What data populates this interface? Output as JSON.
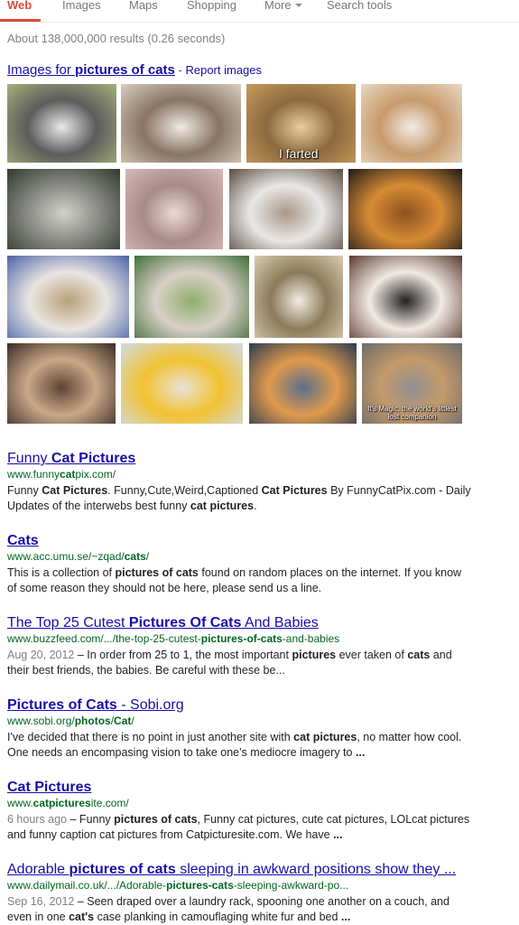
{
  "tabs": [
    "Web",
    "Images",
    "Maps",
    "Shopping",
    "More",
    "Search tools"
  ],
  "stats": "About 138,000,000 results (0.26 seconds)",
  "images_header": {
    "prefix": "Images for ",
    "query": "pictures of cats",
    "separator": " - ",
    "report": "Report images"
  },
  "image_captions": {
    "farted": "I farted",
    "magic_line1": "It's Magic, the world's littlest",
    "magic_line2": "lost companion"
  },
  "image_thumbs": [
    {
      "name": "kittens-group-bw",
      "colors": [
        "#a7b07a",
        "#5c5c5c",
        "#e9e9e9"
      ]
    },
    {
      "name": "tabby-sleeping",
      "colors": [
        "#d8cfc0",
        "#8a7462",
        "#eeeae2"
      ]
    },
    {
      "name": "tabby-smiling",
      "colors": [
        "#c89b5d",
        "#8b6a3f",
        "#e8cf9b"
      ]
    },
    {
      "name": "kitten-straw-hat",
      "colors": [
        "#e8d9c4",
        "#c79a6c",
        "#f2ede6"
      ]
    },
    {
      "name": "grey-kittens-grass",
      "colors": [
        "#2f3a2c",
        "#8a8a86",
        "#cfd3c9"
      ]
    },
    {
      "name": "cat-face-closeup",
      "colors": [
        "#d8b8b8",
        "#a88a8a",
        "#ecdad6"
      ]
    },
    {
      "name": "kittens-basket",
      "colors": [
        "#5a4a3e",
        "#e8e8e8",
        "#a89888"
      ]
    },
    {
      "name": "orange-kitten-toy",
      "colors": [
        "#1c1a18",
        "#d78b34",
        "#8c5220"
      ]
    },
    {
      "name": "three-kittens-blue",
      "colors": [
        "#4a64a8",
        "#e9e5e0",
        "#b9a07a"
      ]
    },
    {
      "name": "three-kittens-garden",
      "colors": [
        "#3f6e38",
        "#d9d0c6",
        "#8fae6e"
      ]
    },
    {
      "name": "tabby-white-portrait",
      "colors": [
        "#d9cdb0",
        "#8d7a5c",
        "#f1ece2"
      ]
    },
    {
      "name": "calico-portrait",
      "colors": [
        "#5c3b2d",
        "#f0e9e4",
        "#222222"
      ]
    },
    {
      "name": "calico-kitten-dark",
      "colors": [
        "#3a2a22",
        "#c9a889",
        "#5e4436"
      ]
    },
    {
      "name": "kitten-duck-hat",
      "colors": [
        "#cfdbe5",
        "#f2c230",
        "#e8e2d8"
      ]
    },
    {
      "name": "orange-kitten-blue",
      "colors": [
        "#2a3b4e",
        "#e09a4d",
        "#5b6f88"
      ]
    },
    {
      "name": "laughing-cat",
      "colors": [
        "#6b6b6b",
        "#c59a6a",
        "#909090"
      ]
    }
  ],
  "results": [
    {
      "title": [
        {
          "t": "Funny ",
          "b": false
        },
        {
          "t": "Cat Pictures",
          "b": true
        }
      ],
      "url": [
        {
          "t": "www.funny",
          "b": false
        },
        {
          "t": "cat",
          "b": true
        },
        {
          "t": "pix.com/",
          "b": false
        }
      ],
      "date": "",
      "snippet": [
        {
          "t": "Funny ",
          "b": false
        },
        {
          "t": "Cat Pictures",
          "b": true
        },
        {
          "t": ". Funny,Cute,Weird,Captioned ",
          "b": false
        },
        {
          "t": "Cat Pictures",
          "b": true
        },
        {
          "t": " By FunnyCatPix.com - Daily Updates of the interwebs best funny ",
          "b": false
        },
        {
          "t": "cat pictures",
          "b": true
        },
        {
          "t": ".",
          "b": false
        }
      ]
    },
    {
      "title": [
        {
          "t": "Cats",
          "b": true
        }
      ],
      "url": [
        {
          "t": "www.acc.umu.se/~zqad/",
          "b": false
        },
        {
          "t": "cats",
          "b": true
        },
        {
          "t": "/",
          "b": false
        }
      ],
      "date": "",
      "snippet": [
        {
          "t": "This is a collection of ",
          "b": false
        },
        {
          "t": "pictures of cats",
          "b": true
        },
        {
          "t": " found on random places on the internet. If you know of some reason they should not be here, please send us a line.",
          "b": false
        }
      ]
    },
    {
      "title": [
        {
          "t": "The Top 25 Cutest ",
          "b": false
        },
        {
          "t": "Pictures Of Cats",
          "b": true
        },
        {
          "t": " And Babies",
          "b": false
        }
      ],
      "url": [
        {
          "t": "www.buzzfeed.com/.../the-top-25-cutest-",
          "b": false
        },
        {
          "t": "pictures-of-cats",
          "b": true
        },
        {
          "t": "-and-babies",
          "b": false
        }
      ],
      "date": "Aug 20, 2012",
      "snippet": [
        {
          "t": " – In order from 25 to 1, the most important ",
          "b": false
        },
        {
          "t": "pictures",
          "b": true
        },
        {
          "t": " ever taken of ",
          "b": false
        },
        {
          "t": "cats",
          "b": true
        },
        {
          "t": " and their best friends, the babies. Be careful with these be...",
          "b": false
        }
      ]
    },
    {
      "title": [
        {
          "t": "Pictures of Cats",
          "b": true
        },
        {
          "t": " - Sobi.org",
          "b": false
        }
      ],
      "url": [
        {
          "t": "www.sobi.org/",
          "b": false
        },
        {
          "t": "photos",
          "b": true
        },
        {
          "t": "/",
          "b": false
        },
        {
          "t": "Cat",
          "b": true
        },
        {
          "t": "/",
          "b": false
        }
      ],
      "date": "",
      "snippet": [
        {
          "t": "I've decided that there is no point in just another site with ",
          "b": false
        },
        {
          "t": "cat pictures",
          "b": true
        },
        {
          "t": ", no matter how cool. One needs an encompasing vision to take one's mediocre imagery to ",
          "b": false
        },
        {
          "t": "...",
          "b": true
        }
      ]
    },
    {
      "title": [
        {
          "t": "Cat Pictures",
          "b": true
        }
      ],
      "url": [
        {
          "t": "www.",
          "b": false
        },
        {
          "t": "catpictures",
          "b": true
        },
        {
          "t": "ite.com/",
          "b": false
        }
      ],
      "date": "6 hours ago",
      "snippet": [
        {
          "t": " – Funny ",
          "b": false
        },
        {
          "t": "pictures of cats",
          "b": true
        },
        {
          "t": ", Funny cat pictures, cute cat pictures, LOLcat pictures and funny caption cat pictures from Catpicturesite.com. We have ",
          "b": false
        },
        {
          "t": "...",
          "b": true
        }
      ]
    },
    {
      "title": [
        {
          "t": "Adorable ",
          "b": false
        },
        {
          "t": "pictures of cats",
          "b": true
        },
        {
          "t": " sleeping in awkward positions show they ...",
          "b": false
        }
      ],
      "url": [
        {
          "t": "www.dailymail.co.uk/.../Adorable-",
          "b": false
        },
        {
          "t": "pictures-cats",
          "b": true
        },
        {
          "t": "-sleeping-awkward-po...",
          "b": false
        }
      ],
      "date": "Sep 16, 2012",
      "snippet": [
        {
          "t": " – Seen draped over a laundry rack, spooning one another on a couch, and even in one ",
          "b": false
        },
        {
          "t": "cat's",
          "b": true
        },
        {
          "t": " case planking in camouflaging white fur and bed ",
          "b": false
        },
        {
          "t": "...",
          "b": true
        }
      ]
    }
  ],
  "colors": {
    "accent": "#dd4b39",
    "link": "#1a0dab",
    "url": "#006621",
    "muted": "#808080"
  }
}
